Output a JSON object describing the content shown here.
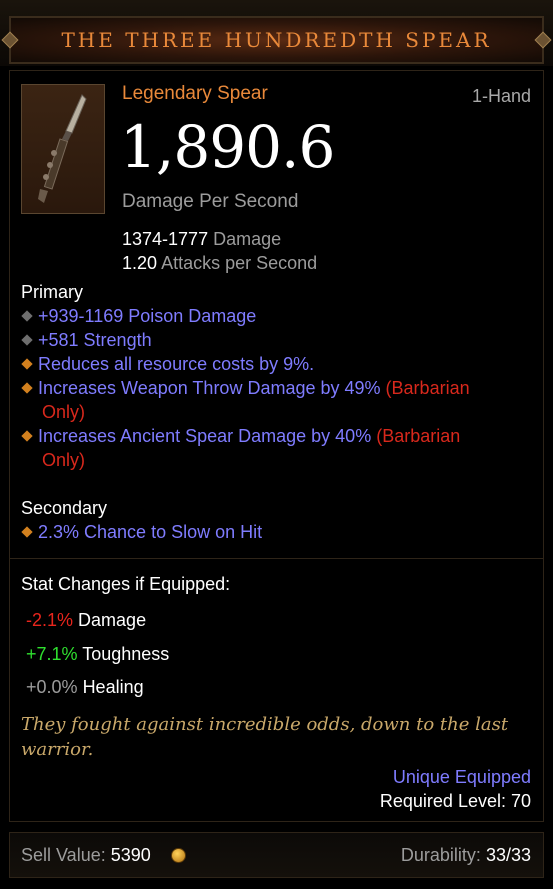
{
  "title": "THE THREE HUNDREDTH SPEAR",
  "item_type": "Legendary Spear",
  "slot": "1-Hand",
  "dps": {
    "value": "1,890.6",
    "label": "Damage Per Second"
  },
  "damage": {
    "value": "1374-1777",
    "label": "Damage"
  },
  "aps": {
    "value": "1.20",
    "label": "Attacks per Second"
  },
  "primary": {
    "label": "Primary",
    "affixes": [
      {
        "text": "+939-1169 Poison Damage",
        "bullet": "gray"
      },
      {
        "text": "+581 Strength",
        "bullet": "gray"
      },
      {
        "text": "Reduces all resource costs by 9%.",
        "bullet": "orange"
      },
      {
        "text": "Increases Weapon Throw Damage by 49%",
        "suffix_a": "(Barbarian",
        "suffix_b": "Only)",
        "bullet": "orange"
      },
      {
        "text": "Increases Ancient Spear Damage by 40%",
        "suffix_a": "(Barbarian",
        "suffix_b": "Only)",
        "bullet": "orange"
      }
    ]
  },
  "secondary": {
    "label": "Secondary",
    "affixes": [
      {
        "text": "2.3% Chance to Slow on Hit",
        "bullet": "orange"
      }
    ]
  },
  "stat_changes": {
    "label": "Stat Changes if Equipped:",
    "rows": [
      {
        "value": "-2.1%",
        "label": "Damage"
      },
      {
        "value": "+7.1%",
        "label": "Toughness"
      },
      {
        "value": "+0.0%",
        "label": "Healing"
      }
    ]
  },
  "flavor_text": "They fought against incredible odds, down to the last warrior.",
  "unique_equipped": "Unique Equipped",
  "required_level": "Required Level: 70",
  "footer": {
    "sell_label": "Sell Value:",
    "sell_value": "5390",
    "durability_label": "Durability:",
    "durability_value": "33/33"
  },
  "colors": {
    "legendary": "#e9893a",
    "magic_affix": "#7f7cff",
    "class_restriction": "#d8281c",
    "stat_negative": "#e8251c",
    "stat_positive": "#2fe02f",
    "flavor": "#c9a86a"
  },
  "icons": [
    "spear-item-icon",
    "gold-coin-icon",
    "gray-diamond-bullet",
    "orange-diamond-bullet"
  ]
}
